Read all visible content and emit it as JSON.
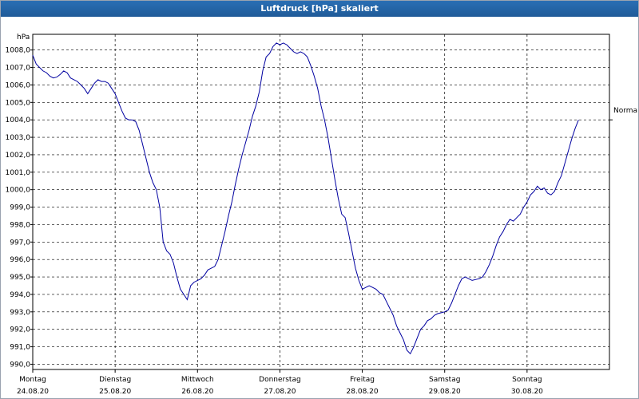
{
  "window": {
    "title": "Luftdruck [hPa] skaliert"
  },
  "chart_data": {
    "type": "line",
    "title": "Luftdruck [hPa] skaliert",
    "ylabel": "hPa",
    "xlabel": "",
    "ylim": [
      989.7,
      1008.9
    ],
    "xlim": [
      0,
      168
    ],
    "yticks": [
      "990,0",
      "991,0",
      "992,0",
      "993,0",
      "994,0",
      "995,0",
      "996,0",
      "997,0",
      "998,0",
      "999,0",
      "1000,0",
      "1001,0",
      "1002,0",
      "1003,0",
      "1004,0",
      "1005,0",
      "1006,0",
      "1007,0",
      "1008,0"
    ],
    "days": [
      {
        "name": "Montag",
        "date": "24.08.20"
      },
      {
        "name": "Dienstag",
        "date": "25.08.20"
      },
      {
        "name": "Mittwoch",
        "date": "26.08.20"
      },
      {
        "name": "Donnerstag",
        "date": "27.08.20"
      },
      {
        "name": "Freitag",
        "date": "28.08.20"
      },
      {
        "name": "Samstag",
        "date": "29.08.20"
      },
      {
        "name": "Sonntag",
        "date": "30.08.20"
      }
    ],
    "grid": true,
    "reference_label": "Normal",
    "reference_value": 1004.0,
    "series": [
      {
        "color": "#0000a0",
        "points": [
          [
            0,
            1007.7
          ],
          [
            1,
            1007.2
          ],
          [
            2,
            1007.0
          ],
          [
            3,
            1006.8
          ],
          [
            4,
            1006.7
          ],
          [
            5,
            1006.5
          ],
          [
            6,
            1006.4
          ],
          [
            7,
            1006.45
          ],
          [
            8,
            1006.6
          ],
          [
            9,
            1006.8
          ],
          [
            10,
            1006.7
          ],
          [
            11,
            1006.4
          ],
          [
            12,
            1006.3
          ],
          [
            13,
            1006.2
          ],
          [
            14,
            1006.0
          ],
          [
            15,
            1005.8
          ],
          [
            16,
            1005.5
          ],
          [
            17,
            1005.8
          ],
          [
            18,
            1006.1
          ],
          [
            19,
            1006.3
          ],
          [
            20,
            1006.2
          ],
          [
            21,
            1006.2
          ],
          [
            22,
            1006.1
          ],
          [
            23,
            1005.8
          ],
          [
            24,
            1005.5
          ],
          [
            25,
            1005.0
          ],
          [
            26,
            1004.5
          ],
          [
            27,
            1004.1
          ],
          [
            28,
            1004.0
          ],
          [
            29,
            1004.0
          ],
          [
            30,
            1003.9
          ],
          [
            31,
            1003.4
          ],
          [
            32,
            1002.6
          ],
          [
            33,
            1001.8
          ],
          [
            34,
            1001.0
          ],
          [
            35,
            1000.4
          ],
          [
            36,
            1000.0
          ],
          [
            37,
            999.0
          ],
          [
            38,
            997.0
          ],
          [
            39,
            996.5
          ],
          [
            40,
            996.3
          ],
          [
            41,
            995.8
          ],
          [
            42,
            995.0
          ],
          [
            43,
            994.3
          ],
          [
            44,
            994.0
          ],
          [
            45,
            993.7
          ],
          [
            46,
            994.5
          ],
          [
            47,
            994.7
          ],
          [
            48,
            994.8
          ],
          [
            49,
            994.9
          ],
          [
            50,
            995.1
          ],
          [
            51,
            995.4
          ],
          [
            52,
            995.5
          ],
          [
            53,
            995.6
          ],
          [
            54,
            996.0
          ],
          [
            55,
            996.8
          ],
          [
            56,
            997.6
          ],
          [
            57,
            998.5
          ],
          [
            58,
            999.3
          ],
          [
            59,
            1000.3
          ],
          [
            60,
            1001.2
          ],
          [
            61,
            1002.0
          ],
          [
            62,
            1002.7
          ],
          [
            63,
            1003.4
          ],
          [
            64,
            1004.2
          ],
          [
            65,
            1004.8
          ],
          [
            66,
            1005.6
          ],
          [
            67,
            1006.8
          ],
          [
            68,
            1007.6
          ],
          [
            69,
            1007.8
          ],
          [
            70,
            1008.2
          ],
          [
            71,
            1008.4
          ],
          [
            72,
            1008.3
          ],
          [
            73,
            1008.4
          ],
          [
            74,
            1008.3
          ],
          [
            75,
            1008.1
          ],
          [
            76,
            1007.9
          ],
          [
            77,
            1007.8
          ],
          [
            78,
            1007.9
          ],
          [
            79,
            1007.8
          ],
          [
            80,
            1007.6
          ],
          [
            81,
            1007.1
          ],
          [
            82,
            1006.5
          ],
          [
            83,
            1005.8
          ],
          [
            84,
            1004.8
          ],
          [
            85,
            1004.0
          ],
          [
            86,
            1003.0
          ],
          [
            87,
            1001.8
          ],
          [
            88,
            1000.6
          ],
          [
            89,
            999.5
          ],
          [
            90,
            998.6
          ],
          [
            91,
            998.4
          ],
          [
            92,
            997.5
          ],
          [
            93,
            996.5
          ],
          [
            94,
            995.5
          ],
          [
            95,
            994.8
          ],
          [
            96,
            994.3
          ],
          [
            97,
            994.4
          ],
          [
            98,
            994.5
          ],
          [
            99,
            994.4
          ],
          [
            100,
            994.3
          ],
          [
            101,
            994.1
          ],
          [
            102,
            994.0
          ],
          [
            103,
            993.6
          ],
          [
            104,
            993.2
          ],
          [
            105,
            992.8
          ],
          [
            106,
            992.2
          ],
          [
            107,
            991.8
          ],
          [
            108,
            991.4
          ],
          [
            109,
            990.8
          ],
          [
            110,
            990.6
          ],
          [
            111,
            991.0
          ],
          [
            112,
            991.5
          ],
          [
            113,
            992.0
          ],
          [
            114,
            992.2
          ],
          [
            115,
            992.5
          ],
          [
            116,
            992.6
          ],
          [
            117,
            992.8
          ],
          [
            118,
            992.9
          ],
          [
            119,
            992.95
          ],
          [
            120,
            993.0
          ],
          [
            121,
            993.1
          ],
          [
            122,
            993.5
          ],
          [
            123,
            994.0
          ],
          [
            124,
            994.5
          ],
          [
            125,
            994.9
          ],
          [
            126,
            995.0
          ],
          [
            127,
            994.9
          ],
          [
            128,
            994.8
          ],
          [
            129,
            994.85
          ],
          [
            130,
            994.9
          ],
          [
            131,
            995.0
          ],
          [
            132,
            995.3
          ],
          [
            133,
            995.7
          ],
          [
            134,
            996.2
          ],
          [
            135,
            996.8
          ],
          [
            136,
            997.3
          ],
          [
            137,
            997.6
          ],
          [
            138,
            998.0
          ],
          [
            139,
            998.3
          ],
          [
            140,
            998.2
          ],
          [
            141,
            998.4
          ],
          [
            142,
            998.6
          ],
          [
            143,
            999.0
          ],
          [
            144,
            999.3
          ],
          [
            145,
            999.7
          ],
          [
            146,
            999.9
          ],
          [
            147,
            1000.2
          ],
          [
            148,
            1000.0
          ],
          [
            149,
            1000.1
          ],
          [
            150,
            999.8
          ],
          [
            151,
            999.7
          ],
          [
            152,
            999.9
          ],
          [
            153,
            1000.4
          ],
          [
            154,
            1000.8
          ],
          [
            155,
            1001.5
          ],
          [
            156,
            1002.2
          ],
          [
            157,
            1002.9
          ],
          [
            158,
            1003.5
          ],
          [
            159,
            1004.0
          ]
        ]
      }
    ]
  }
}
